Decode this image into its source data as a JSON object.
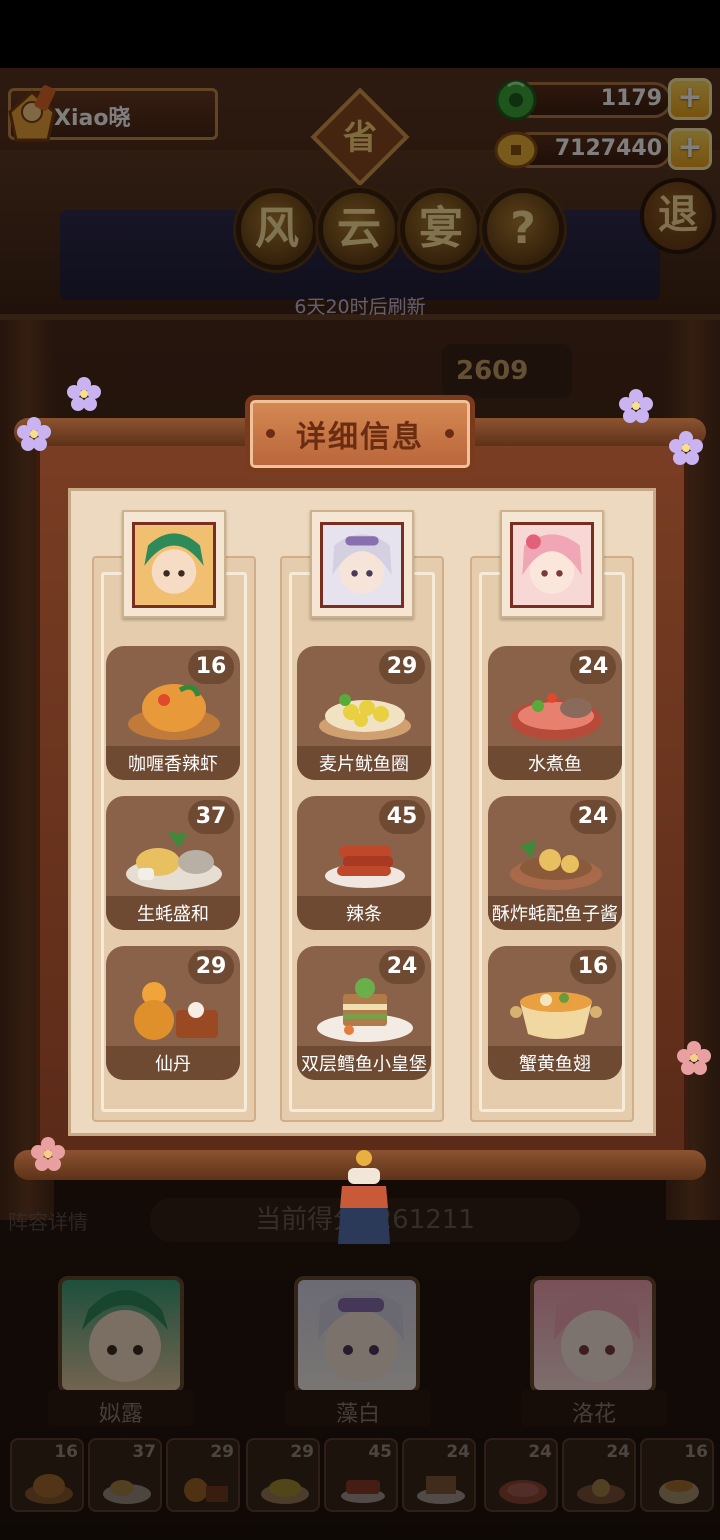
{
  "player": {
    "name": "Xiao晓"
  },
  "resources": {
    "jade": {
      "value": "1179",
      "icon": "jade-coin-icon",
      "color": "#3fa83a"
    },
    "gold": {
      "value": "7127440",
      "icon": "gold-coin-icon",
      "color": "#e8a72b"
    },
    "plus_label": "+"
  },
  "event": {
    "badge": "省",
    "title_chars": [
      "风",
      "云",
      "宴"
    ],
    "help_label": "?",
    "exit_label": "退",
    "refresh_text": "6天20时后刷新",
    "score_peek": "2609"
  },
  "panel": {
    "title": "详细信息",
    "columns": [
      {
        "hero_icon": "hero-portrait-green-icon",
        "dishes": [
          {
            "name": "咖喱香辣虾",
            "count": "16",
            "icon": "curry-shrimp-icon"
          },
          {
            "name": "生蚝盛和",
            "count": "37",
            "icon": "oyster-platter-icon"
          },
          {
            "name": "仙丹",
            "count": "29",
            "icon": "elixir-gourd-icon"
          }
        ]
      },
      {
        "hero_icon": "hero-portrait-silver-icon",
        "dishes": [
          {
            "name": "麦片鱿鱼圈",
            "count": "29",
            "icon": "squid-rings-icon"
          },
          {
            "name": "辣条",
            "count": "45",
            "icon": "spicy-strips-icon"
          },
          {
            "name": "双层鳕鱼小皇堡",
            "count": "24",
            "icon": "cod-burger-icon"
          }
        ]
      },
      {
        "hero_icon": "hero-portrait-pink-icon",
        "dishes": [
          {
            "name": "水煮鱼",
            "count": "24",
            "icon": "boiled-fish-icon"
          },
          {
            "name": "酥炸蚝配鱼子酱",
            "count": "24",
            "icon": "fried-oyster-caviar-icon"
          },
          {
            "name": "蟹黄鱼翅",
            "count": "16",
            "icon": "crab-roe-soup-icon"
          }
        ]
      }
    ]
  },
  "lineup": {
    "title": "阵容详情",
    "current_score": "当前得分1261211",
    "heroes": [
      {
        "name": "姒露",
        "icon": "hero-green-icon"
      },
      {
        "name": "藻白",
        "icon": "hero-silver-icon"
      },
      {
        "name": "洛花",
        "icon": "hero-pink-icon"
      }
    ],
    "dish_counts": [
      "16",
      "37",
      "29",
      "29",
      "45",
      "24",
      "24",
      "24",
      "16"
    ]
  }
}
